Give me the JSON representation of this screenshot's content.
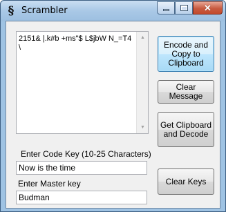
{
  "window": {
    "title": "Scrambler",
    "app_icon_glyph": "§",
    "close_glyph": "✕"
  },
  "message": {
    "text": "2151& |.k#b +ms\"$ L$jbW N_=T4\n\\"
  },
  "buttons": {
    "encode": [
      "Encode and",
      "Copy to",
      "Clipboard"
    ],
    "clear_message": [
      "Clear",
      "Message"
    ],
    "decode": [
      "Get Clipboard",
      "and Decode"
    ],
    "clear_keys": "Clear Keys"
  },
  "code_key": {
    "label": "Enter Code Key (10-25 Characters)",
    "value": "Now is the time"
  },
  "master_key": {
    "label": "Enter Master key",
    "value": "Budman"
  },
  "icons": {
    "scroll_up": "▲",
    "scroll_down": "▼"
  },
  "colors": {
    "title_bar": "#a9c8e6",
    "close_button": "#c75a40",
    "default_button_border": "#3c7fb1",
    "client_background": "#f0f0f0"
  }
}
